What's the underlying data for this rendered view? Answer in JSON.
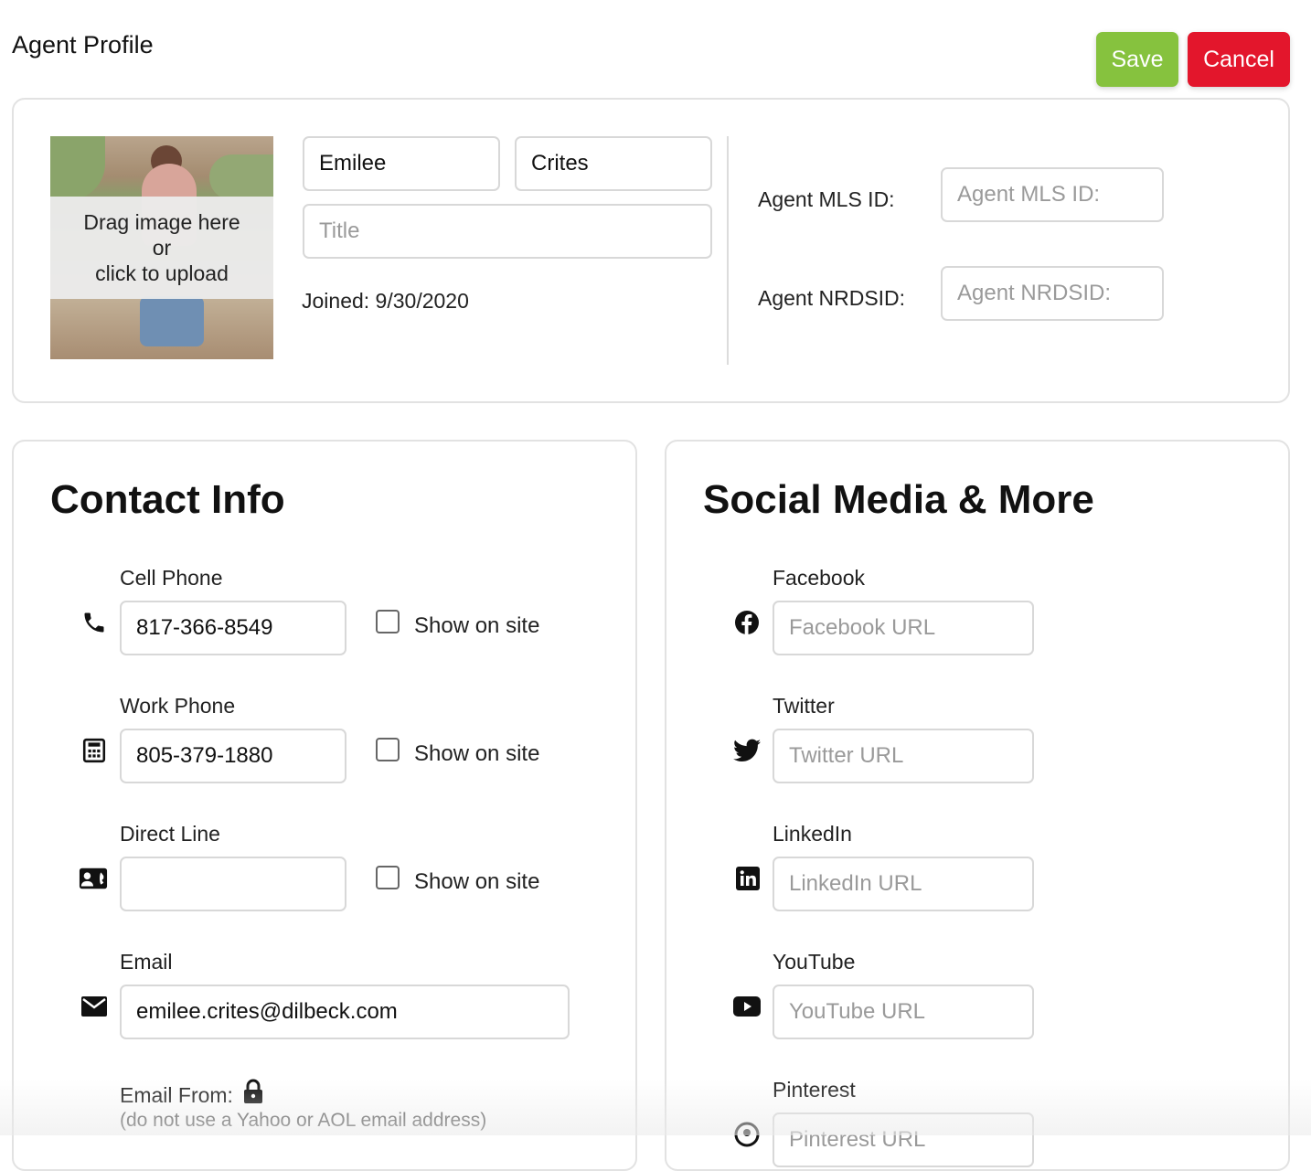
{
  "header": {
    "title": "Agent Profile",
    "save_label": "Save",
    "cancel_label": "Cancel"
  },
  "profile": {
    "upload_line1": "Drag image here",
    "upload_line2": "or",
    "upload_line3": "click to upload",
    "first_name": "Emilee",
    "last_name": "Crites",
    "title_placeholder": "Title",
    "joined": "Joined: 9/30/2020",
    "mls_label": "Agent MLS ID:",
    "mls_placeholder": "Agent MLS ID:",
    "nrds_label": "Agent NRDSID:",
    "nrds_placeholder": "Agent NRDSID:"
  },
  "contact": {
    "heading": "Contact Info",
    "show_on_site": "Show on site",
    "cell_label": "Cell Phone",
    "cell_value": "817-366-8549",
    "work_label": "Work Phone",
    "work_value": "805-379-1880",
    "direct_label": "Direct Line",
    "direct_value": "",
    "email_label": "Email",
    "email_value": "emilee.crites@dilbeck.com",
    "email_from_label": "Email From:",
    "email_from_note": "(do not use a Yahoo or AOL email address)"
  },
  "social": {
    "heading": "Social Media & More",
    "facebook_label": "Facebook",
    "facebook_placeholder": "Facebook URL",
    "twitter_label": "Twitter",
    "twitter_placeholder": "Twitter URL",
    "linkedin_label": "LinkedIn",
    "linkedin_placeholder": "LinkedIn URL",
    "youtube_label": "YouTube",
    "youtube_placeholder": "YouTube URL",
    "pinterest_label": "Pinterest",
    "pinterest_placeholder": "Pinterest URL"
  },
  "colors": {
    "save": "#86c23e",
    "cancel": "#e3162c"
  },
  "icons": [
    "phone-icon",
    "office-phone-icon",
    "contact-card-icon",
    "mail-icon",
    "lock-icon",
    "facebook-icon",
    "twitter-icon",
    "linkedin-icon",
    "youtube-icon",
    "pinterest-icon"
  ]
}
